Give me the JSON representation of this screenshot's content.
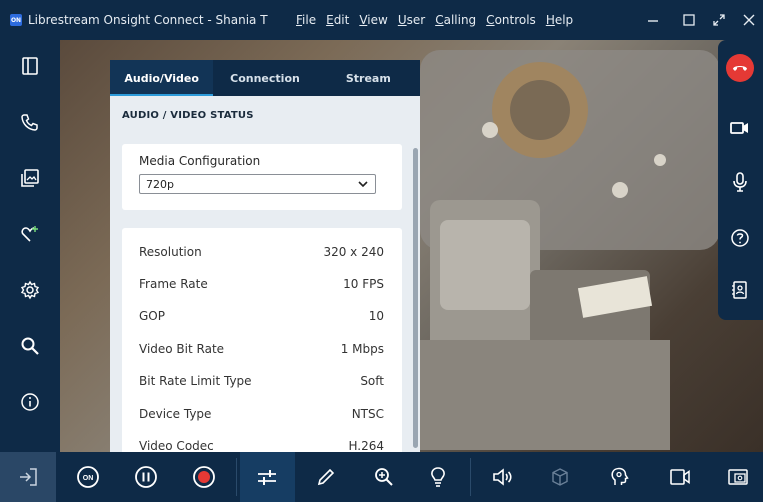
{
  "window": {
    "title": "Librestream Onsight Connect - Shania T",
    "logo_text": "ON",
    "menu": [
      "File",
      "Edit",
      "View",
      "User",
      "Calling",
      "Controls",
      "Help"
    ]
  },
  "panel": {
    "tabs": [
      "Audio/Video",
      "Connection",
      "Stream"
    ],
    "active_tab": "Audio/Video",
    "section_title": "AUDIO / VIDEO STATUS",
    "media_configuration": {
      "label": "Media Configuration",
      "selected": "720p"
    },
    "stats": [
      {
        "label": "Resolution",
        "value": "320 x 240"
      },
      {
        "label": "Frame Rate",
        "value": "10 FPS"
      },
      {
        "label": "GOP",
        "value": "10"
      },
      {
        "label": "Video Bit Rate",
        "value": "1 Mbps"
      },
      {
        "label": "Bit Rate Limit Type",
        "value": "Soft"
      },
      {
        "label": "Device Type",
        "value": "NTSC"
      },
      {
        "label": "Video Codec",
        "value": "H.264"
      }
    ]
  },
  "colors": {
    "chrome": "#0e2a47",
    "end_call": "#e53935",
    "record": "#e53935",
    "active_tab_accent": "#2d9cdb"
  },
  "icons": {
    "left_bar": [
      "panel-toggle-icon",
      "phone-icon",
      "gallery-icon",
      "favorites-icon",
      "settings-icon",
      "search-icon",
      "info-icon"
    ],
    "right_bar": [
      "end-call-icon",
      "video-camera-icon",
      "microphone-icon",
      "help-icon",
      "contacts-icon"
    ],
    "bottom_bar": [
      "exit-icon",
      "on-toggle-icon",
      "pause-icon",
      "record-icon",
      "adjustments-icon",
      "pen-icon",
      "zoom-in-icon",
      "lightbulb-icon",
      "speaker-icon",
      "3d-box-icon",
      "head-settings-icon",
      "camera-switch-icon",
      "picture-in-picture-icon"
    ]
  },
  "bottom_bar": {
    "on_label": "ON"
  }
}
